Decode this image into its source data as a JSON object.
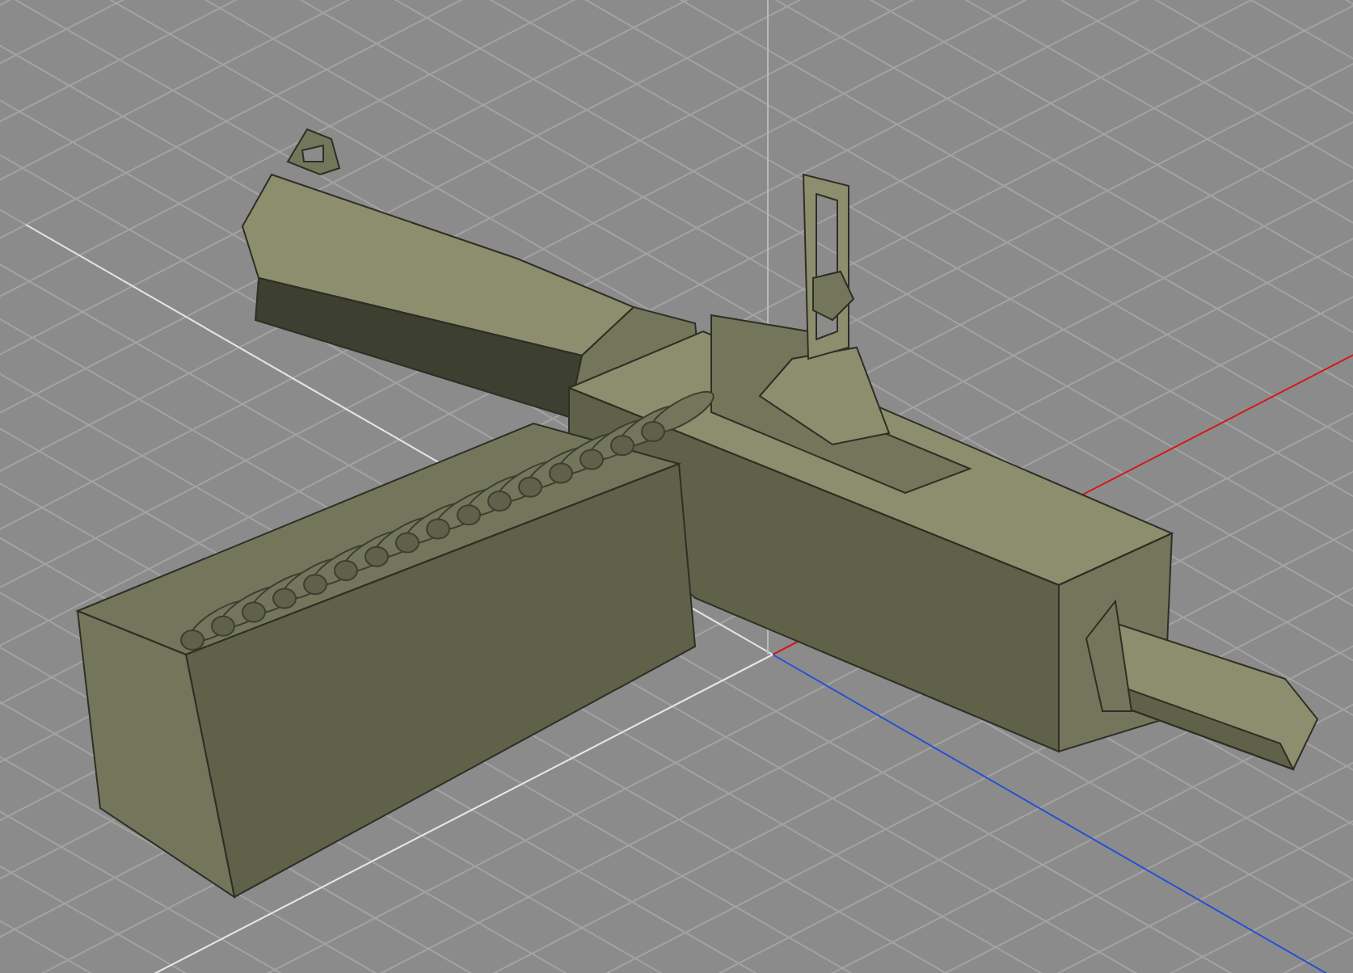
{
  "viewport": {
    "grid": true,
    "axes": true
  }
}
